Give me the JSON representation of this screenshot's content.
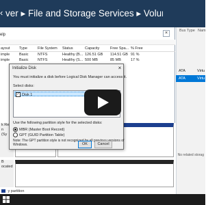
{
  "header": {
    "back_glyph": "‹",
    "breadcrumb": "ver ▸ File and Storage Services ▸ Volumes ▸ Disks"
  },
  "disk_mgmt": {
    "menu_help": "elp",
    "volume_columns": [
      "ayout",
      "Type",
      "File System",
      "Status",
      "Capacity",
      "Free Spa...",
      "% Free"
    ],
    "volumes": [
      {
        "layout": "imple",
        "type": "Basic",
        "fs": "NTFS",
        "status": "Healthy (B...",
        "capacity": "126.51 GB",
        "free": "114.51 GB",
        "pct": "91 %"
      },
      {
        "layout": "imple",
        "type": "Basic",
        "fs": "NTFS",
        "status": "Healthy (S...",
        "capacity": "500 MB",
        "free": "85 MB",
        "pct": "17 %"
      }
    ],
    "disk_labels": [
      "k Re",
      "n",
      "(Sy"
    ],
    "disk2_labels": [
      "B",
      "ocated",
      ""
    ],
    "legend": "y partition"
  },
  "right_panel": {
    "columns": [
      "Bus Type",
      "Nam"
    ],
    "rows": [
      {
        "bus": "ATA",
        "name": "Virtu",
        "selected": false
      },
      {
        "bus": "ATA",
        "name": "Virtu",
        "selected": true
      }
    ],
    "empty_text": "No related storag"
  },
  "dialog": {
    "title": "Initialize Disk",
    "intro": "You must initialize a disk before Logical Disk Manager can access it.",
    "select_label": "Select disks:",
    "disk_item": "Disk 1",
    "partition_label": "Use the following partition style for the selected disks:",
    "options": [
      {
        "label": "MBR (Master Boot Record)",
        "selected": true
      },
      {
        "label": "GPT (GUID Partition Table)",
        "selected": false
      }
    ],
    "note_line1": "Note: The GPT partition style is not recognized by all previous versions of",
    "note_line2": "Windows.",
    "ok_label": "OK",
    "cancel_label": "Cancel"
  },
  "colors": {
    "header_bg": "#1f3b5a",
    "selection": "#0078d7",
    "taskbar": "#1c1c1c"
  },
  "icons": [
    "back-icon",
    "close-icon",
    "checkbox-icon",
    "radio-icon",
    "play-icon",
    "windows-start-icon"
  ]
}
